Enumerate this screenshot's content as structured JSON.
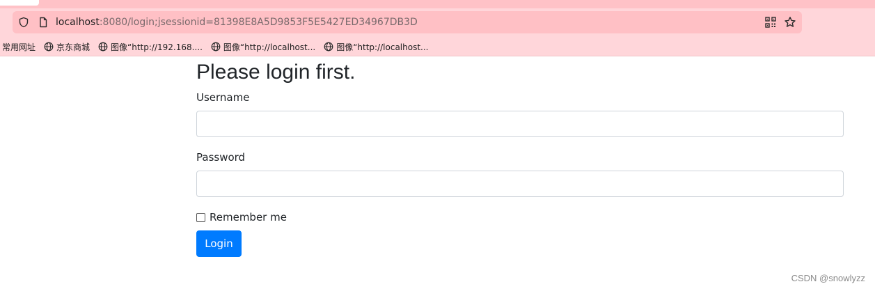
{
  "browser": {
    "address": {
      "host": "localhost",
      "rest": ":8080/login;jsessionid=81398E8A5D9853F5E5427ED34967DB3D"
    },
    "icons": {
      "shield": "shield-icon",
      "page": "page-icon",
      "qr": "qr-code-icon",
      "favorite": "star-icon",
      "bookmark_globe": "globe-icon"
    },
    "bookmarks": [
      {
        "label": "常用网址"
      },
      {
        "label": "京东商城"
      },
      {
        "label": "图像“http://192.168...."
      },
      {
        "label": "图像“http://localhost..."
      },
      {
        "label": "图像“http://localhost..."
      }
    ]
  },
  "page": {
    "title": "Please login first.",
    "username_label": "Username",
    "username_value": "",
    "password_label": "Password",
    "password_value": "",
    "remember_label": "Remember me",
    "login_label": "Login"
  },
  "watermark": "CSDN @snowlyzz",
  "colors": {
    "chrome_bg": "#ffd6da",
    "address_bg": "#ffc0c5",
    "primary_button": "#007bff"
  }
}
